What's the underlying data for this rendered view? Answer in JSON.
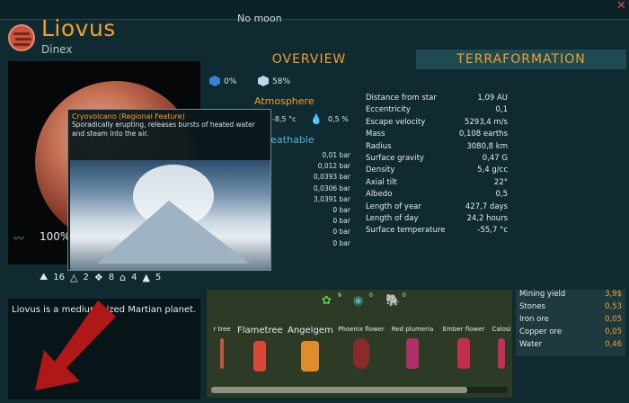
{
  "header": {
    "moon_label": "No moon",
    "planet_name": "Liovus",
    "system_name": "Dinex",
    "close_icon": "close-icon"
  },
  "tabs": [
    {
      "label": "OVERVIEW",
      "active": false
    },
    {
      "label": "TERRAFORMATION",
      "active": true
    }
  ],
  "top_stats": {
    "stat1": "0%",
    "stat2": "58%"
  },
  "atmosphere": {
    "title": "Atmosphere",
    "temperature": "-8,5 °c",
    "water": "0,5 %",
    "breathable_label": "reathable",
    "gases": [
      "0,01 bar",
      "0,012 bar",
      "0,0393 bar",
      "0,0306 bar",
      "3,0391 bar",
      "0 bar",
      "0 bar",
      "0 bar",
      "0 bar"
    ]
  },
  "orbit_stats": [
    {
      "label": "Distance from star",
      "value": "1,09 AU"
    },
    {
      "label": "Eccentricity",
      "value": "0,1"
    },
    {
      "label": "Escape velocity",
      "value": "5293,4 m/s"
    },
    {
      "label": "Mass",
      "value": "0,108 earths"
    },
    {
      "label": "Radius",
      "value": "3080,8 km"
    },
    {
      "label": "Surface gravity",
      "value": "0,47 G"
    },
    {
      "label": "Density",
      "value": "5,4 g/cc"
    },
    {
      "label": "Axial tilt",
      "value": "22°"
    },
    {
      "label": "Albedo",
      "value": "0,5"
    },
    {
      "label": "Length of year",
      "value": "427,7 days"
    },
    {
      "label": "Length of day",
      "value": "24,2 hours"
    },
    {
      "label": "Surface temperature",
      "value": "-55,7 °c"
    }
  ],
  "tooltip": {
    "title": "Cryovolcano (Regional Feature)",
    "description": "Sporadically erupting, releases bursts of heated water and steam into the air."
  },
  "planet_view": {
    "integrity": "100%"
  },
  "counts": [
    "16",
    "2",
    "8",
    "4",
    "5"
  ],
  "description": "Liovus is a medium-sized Martian planet.",
  "life": {
    "plants_count": "9",
    "microbes_count": "0",
    "animals_count": "0",
    "plants": [
      {
        "name": "r tree",
        "color": "#c0573a"
      },
      {
        "name": "Flametree",
        "color": "#d9473a"
      },
      {
        "name": "Angelgem",
        "color": "#e08c2a"
      },
      {
        "name": "Phoenix flower",
        "color": "#8a2b2b"
      },
      {
        "name": "Red plumeria",
        "color": "#b0306a"
      },
      {
        "name": "Ember flower",
        "color": "#c0304a"
      },
      {
        "name": "Calosi",
        "color": "#c0305a"
      }
    ]
  },
  "resources": [
    {
      "label": "Mining yield",
      "value": "3,9$"
    },
    {
      "label": "Stones",
      "value": "0,53"
    },
    {
      "label": "Iron ore",
      "value": "0,05"
    },
    {
      "label": "Copper ore",
      "value": "0,05"
    },
    {
      "label": "Water",
      "value": "0,46"
    }
  ]
}
